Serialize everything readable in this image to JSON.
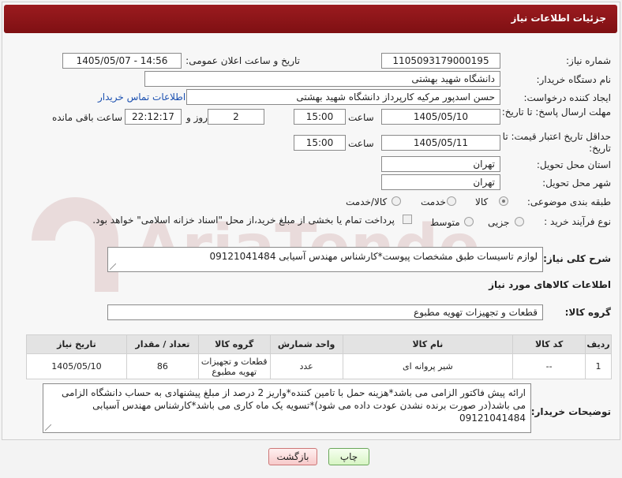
{
  "page": {
    "header_title": "جزئیات اطلاعات نیاز"
  },
  "fields": {
    "need_number": {
      "label": "شماره نیاز:",
      "value": "1105093179000195"
    },
    "announce": {
      "label": "تاریخ و ساعت اعلان عمومی:",
      "value": "1405/05/07 - 14:56"
    },
    "buyer_org": {
      "label": "نام دستگاه خریدار:",
      "value": "دانشگاه شهید بهشتی"
    },
    "creator": {
      "label": "ایجاد کننده درخواست:",
      "value": "حسن اسدپور مرکیه کارپرداز دانشگاه شهید بهشتی",
      "contact_link": "اطلاعات تماس خریدار"
    },
    "reply_deadline": {
      "label": "مهلت ارسال پاسخ: تا تاریخ:",
      "date": "1405/05/10",
      "time_label": "ساعت",
      "time": "15:00",
      "days": "2",
      "days_label": "روز و",
      "remaining": "22:12:17",
      "remaining_label": "ساعت باقی مانده"
    },
    "price_validity": {
      "label": "حداقل تاریخ اعتبار قیمت: تا تاریخ:",
      "date": "1405/05/11",
      "time_label": "ساعت",
      "time": "15:00"
    },
    "province": {
      "label": "استان محل تحویل:",
      "value": "تهران"
    },
    "city": {
      "label": "شهر محل تحویل:",
      "value": "تهران"
    },
    "category": {
      "label": "طبقه بندی موضوعی:",
      "options": [
        "کالا",
        "خدمت",
        "کالا/خدمت"
      ],
      "selected": "کالا"
    },
    "process": {
      "label": "نوع فرآیند خرید :",
      "options": [
        "جزیی",
        "متوسط"
      ],
      "payment_note": "پرداخت تمام یا بخشی از مبلغ خرید،از محل \"اسناد خزانه اسلامی\" خواهد بود."
    },
    "summary": {
      "label": "شرح کلی نیاز:",
      "value": "لوازم تاسیسات طبق مشخصات پیوست*کارشناس مهندس آسیابی 09121041484"
    }
  },
  "goods": {
    "section_title": "اطلاعات کالاهای مورد نیاز",
    "group_label": "گروه کالا:",
    "group_value": "قطعات و تجهیزات تهویه مطبوع",
    "columns": [
      "ردیف",
      "کد کالا",
      "نام کالا",
      "واحد شمارش",
      "گروه کالا",
      "تعداد / مقدار",
      "تاریخ نیاز"
    ],
    "rows": [
      {
        "row": "1",
        "code": "--",
        "name": "شیر پروانه ای",
        "unit": "عدد",
        "group": "قطعات و تجهیزات تهویه مطبوع",
        "qty": "86",
        "date": "1405/05/10"
      }
    ]
  },
  "buyer_notes": {
    "label": "توضیحات خریدار:",
    "value": "ارائه پیش فاکتور الزامی می باشد*هزینه حمل با تامین کننده*واریز 2 درصد از مبلغ پیشنهادی به حساب دانشگاه الزامی می باشد(در صورت برنده نشدن عودت داده می شود)*تسویه یک ماه کاری می باشد*کارشناس مهندس آسیابی 09121041484"
  },
  "buttons": {
    "print": "چاپ",
    "back": "بازگشت"
  },
  "watermark": "AriaTender.net",
  "colors": {
    "header": "#8b1418",
    "link": "#1b50b0"
  }
}
